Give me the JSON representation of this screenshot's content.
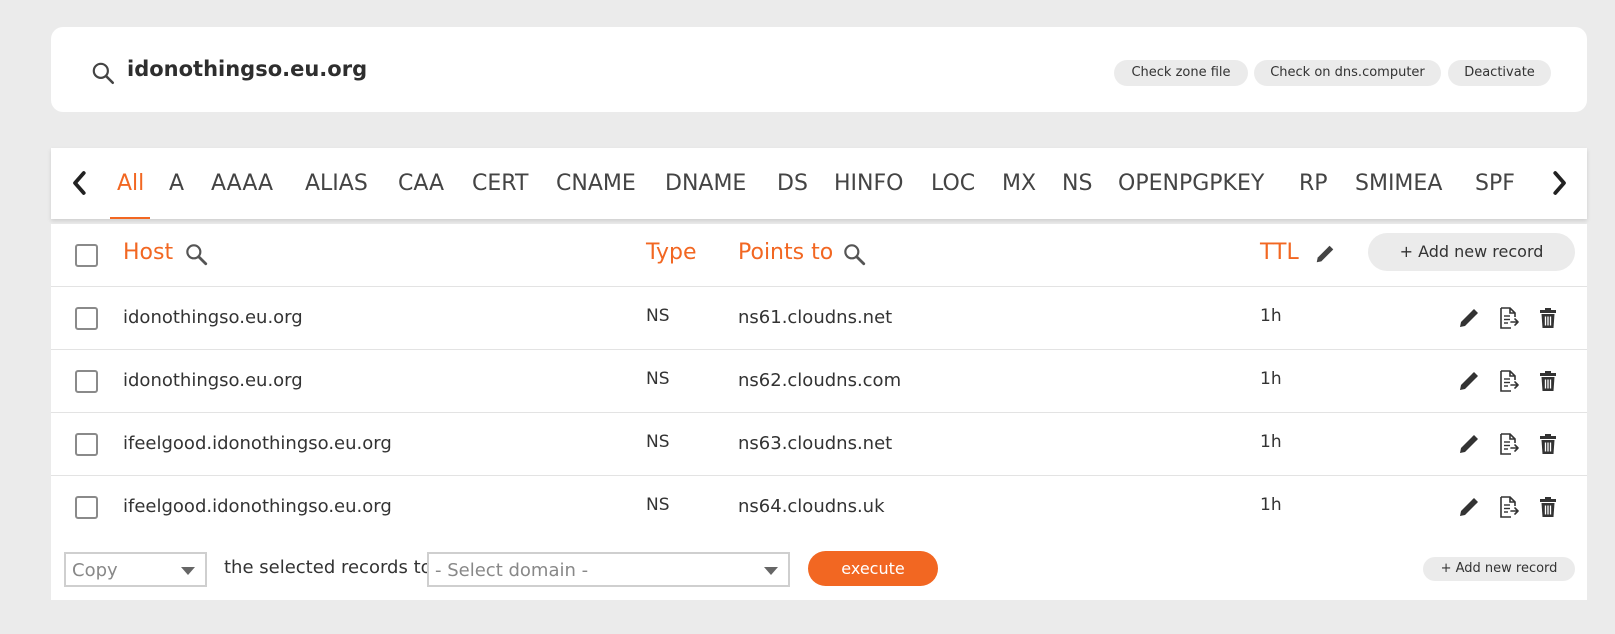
{
  "zone": {
    "name": "idonothingso.eu.org",
    "actions": [
      "Check zone file",
      "Check on dns.computer",
      "Deactivate"
    ]
  },
  "tabs": {
    "items": [
      "All",
      "A",
      "AAAA",
      "ALIAS",
      "CAA",
      "CERT",
      "CNAME",
      "DNAME",
      "DS",
      "HINFO",
      "LOC",
      "MX",
      "NS",
      "OPENPGPKEY",
      "RP",
      "SMIMEA",
      "SPF"
    ],
    "active": "All"
  },
  "table": {
    "headers": {
      "host": "Host",
      "type": "Type",
      "points_to": "Points to",
      "ttl": "TTL"
    },
    "add_label": "+ Add new record",
    "rows": [
      {
        "host": "idonothingso.eu.org",
        "type": "NS",
        "points_to": "ns61.cloudns.net",
        "ttl": "1h"
      },
      {
        "host": "idonothingso.eu.org",
        "type": "NS",
        "points_to": "ns62.cloudns.com",
        "ttl": "1h"
      },
      {
        "host": "ifeelgood.idonothingso.eu.org",
        "type": "NS",
        "points_to": "ns63.cloudns.net",
        "ttl": "1h"
      },
      {
        "host": "ifeelgood.idonothingso.eu.org",
        "type": "NS",
        "points_to": "ns64.cloudns.uk",
        "ttl": "1h"
      }
    ]
  },
  "footer": {
    "action_select": "Copy",
    "text": "the selected records to",
    "domain_select": "- Select domain -",
    "execute_label": "execute",
    "add_label": "+ Add new record"
  },
  "colors": {
    "accent": "#f26722",
    "background": "#ebebeb",
    "pill": "#ebebeb"
  },
  "icons": [
    "search-icon",
    "chevron-left-icon",
    "chevron-right-icon",
    "pencil-icon",
    "export-icon",
    "trash-icon"
  ]
}
